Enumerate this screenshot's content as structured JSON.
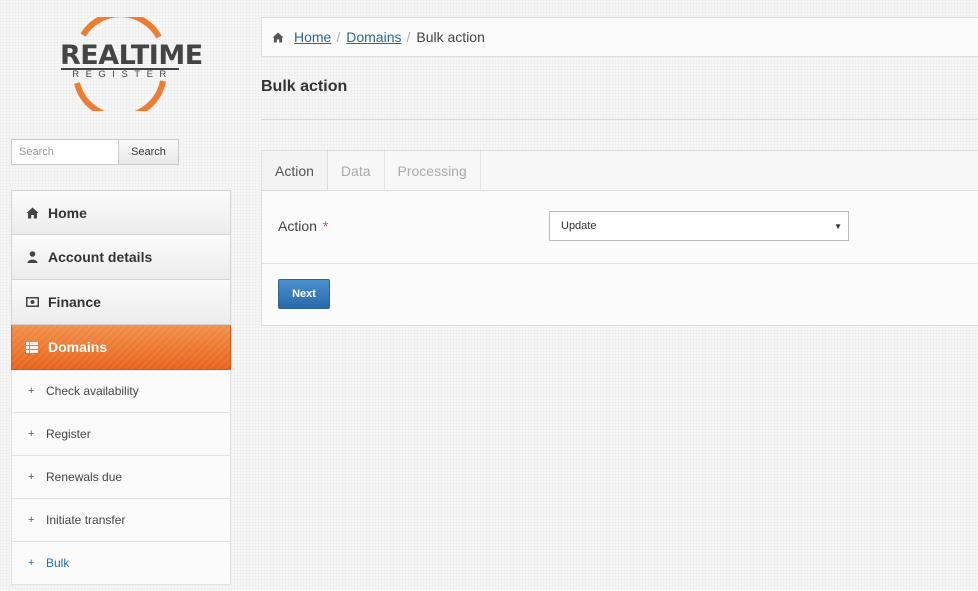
{
  "logo": {
    "word": "REALTIME",
    "sub": "REGISTER",
    "ring_color": "#ee7d32"
  },
  "search": {
    "placeholder": "Search",
    "button": "Search"
  },
  "sidebar": {
    "items": [
      {
        "label": "Home",
        "icon": "home-icon"
      },
      {
        "label": "Account details",
        "icon": "user-icon"
      },
      {
        "label": "Finance",
        "icon": "money-icon"
      },
      {
        "label": "Domains",
        "icon": "list-icon",
        "active": true
      }
    ],
    "subitems": [
      {
        "label": "Check availability"
      },
      {
        "label": "Register"
      },
      {
        "label": "Renewals due"
      },
      {
        "label": "Initiate transfer"
      },
      {
        "label": "Bulk",
        "current": true
      }
    ],
    "plus": "+"
  },
  "breadcrumb": {
    "home": "Home",
    "domains": "Domains",
    "current": "Bulk action",
    "separator": "/"
  },
  "page": {
    "title": "Bulk action"
  },
  "tabs": [
    "Action",
    "Data",
    "Processing"
  ],
  "form": {
    "label": "Action",
    "required": "*",
    "select_value": "Update"
  },
  "buttons": {
    "next": "Next"
  },
  "colors": {
    "accent": "#ee7d32",
    "link": "#2f6a94",
    "primary_button": "#2a6aa8"
  }
}
